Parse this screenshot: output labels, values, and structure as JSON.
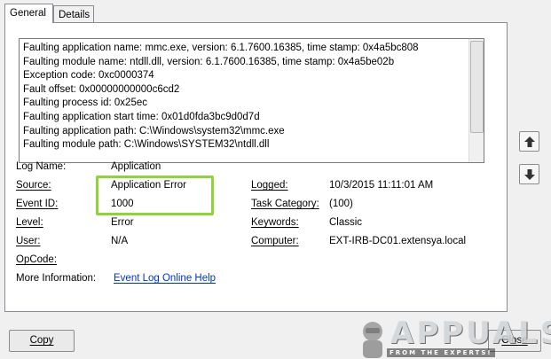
{
  "tabs": [
    {
      "label": "General",
      "active": true
    },
    {
      "label": "Details",
      "active": false
    }
  ],
  "description_lines": [
    "Faulting application name: mmc.exe, version: 6.1.7600.16385, time stamp: 0x4a5bc808",
    "Faulting module name: ntdll.dll, version: 6.1.7600.16385, time stamp: 0x4a5be02b",
    "Exception code: 0xc0000374",
    "Fault offset: 0x00000000000c6cd2",
    "Faulting process id: 0x25ec",
    "Faulting application start time: 0x01d0fda3bc9d0d7d",
    "Faulting application path: C:\\Windows\\system32\\mmc.exe",
    "Faulting module path: C:\\Windows\\SYSTEM32\\ntdll.dll"
  ],
  "fields": {
    "log_name": {
      "label": "Log Name:",
      "value": "Application"
    },
    "source": {
      "label": "Source:",
      "value": "Application Error"
    },
    "event_id": {
      "label": "Event ID:",
      "value": "1000"
    },
    "level": {
      "label": "Level:",
      "value": "Error"
    },
    "user": {
      "label": "User:",
      "value": "N/A"
    },
    "opcode": {
      "label": "OpCode:",
      "value": ""
    },
    "more_info": {
      "label": "More Information:",
      "link": "Event Log Online Help"
    },
    "logged": {
      "label": "Logged:",
      "value": "10/3/2015 11:11:01 AM"
    },
    "task_category": {
      "label": "Task Category:",
      "value": "(100)"
    },
    "keywords": {
      "label": "Keywords:",
      "value": "Classic"
    },
    "computer": {
      "label": "Computer:",
      "value": "EXT-IRB-DC01.extensya.local"
    }
  },
  "buttons": {
    "copy": "Copy",
    "close": "Close"
  },
  "side_buttons": {
    "up_icon": "arrow-up-icon",
    "down_icon": "arrow-down-icon"
  },
  "watermark": {
    "text": "APPUALS",
    "tagline": "FROM THE EXPERTS!"
  },
  "colors": {
    "highlight": "#8fd23c",
    "link": "#0033cc"
  }
}
